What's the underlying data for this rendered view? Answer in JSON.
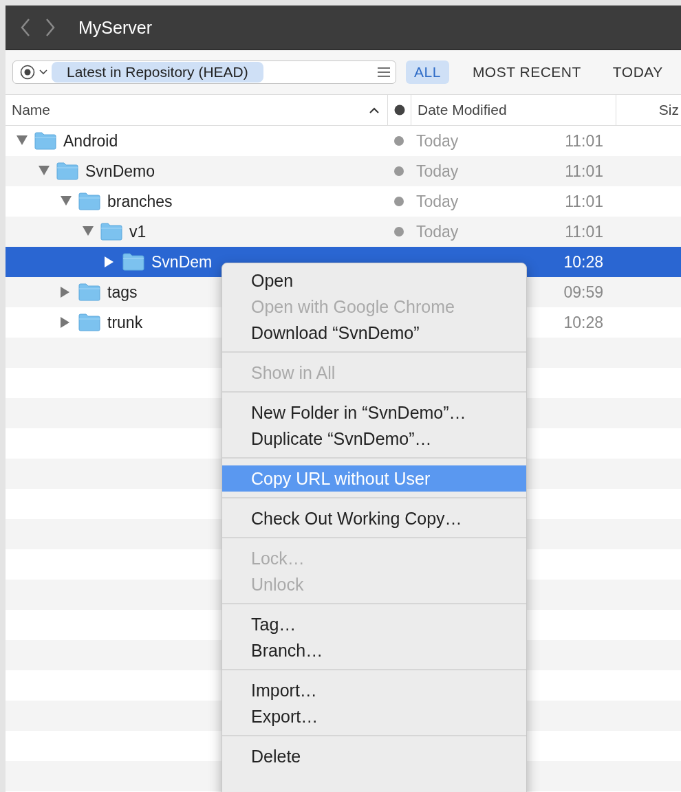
{
  "window": {
    "title": "MyServer"
  },
  "toolbar": {
    "revision": "Latest in Repository (HEAD)",
    "filters": [
      {
        "label": "ALL",
        "selected": true
      },
      {
        "label": "MOST RECENT",
        "selected": false
      },
      {
        "label": "TODAY",
        "selected": false
      }
    ]
  },
  "columns": [
    "Name",
    "Date Modified",
    "Siz"
  ],
  "tree": [
    {
      "name": "Android",
      "expanded": true,
      "selected": false,
      "date": "Today",
      "time": "11:01",
      "children": [
        {
          "name": "SvnDemo",
          "expanded": true,
          "selected": false,
          "date": "Today",
          "time": "11:01",
          "children": [
            {
              "name": "branches",
              "expanded": true,
              "selected": false,
              "date": "Today",
              "time": "11:01",
              "children": [
                {
                  "name": "v1",
                  "expanded": true,
                  "selected": false,
                  "date": "Today",
                  "time": "11:01",
                  "children": [
                    {
                      "name": "SvnDem",
                      "expanded": false,
                      "selected": true,
                      "time": "10:28"
                    }
                  ]
                }
              ]
            },
            {
              "name": "tags",
              "expanded": false,
              "selected": false,
              "time": "09:59"
            },
            {
              "name": "trunk",
              "expanded": false,
              "selected": false,
              "time": "10:28"
            }
          ]
        }
      ]
    }
  ],
  "menu": {
    "groups": [
      {
        "items": [
          {
            "label": "Open",
            "disabled": false,
            "selected": false
          },
          {
            "label": "Open with Google Chrome",
            "disabled": true,
            "selected": false
          },
          {
            "label": "Download “SvnDemo”",
            "disabled": false,
            "selected": false
          }
        ]
      },
      {
        "items": [
          {
            "label": "Show in All",
            "disabled": true,
            "selected": false
          }
        ]
      },
      {
        "items": [
          {
            "label": "New Folder in “SvnDemo”…",
            "disabled": false,
            "selected": false
          },
          {
            "label": "Duplicate “SvnDemo”…",
            "disabled": false,
            "selected": false
          }
        ]
      },
      {
        "items": [
          {
            "label": "Copy URL without User",
            "disabled": false,
            "selected": true
          }
        ]
      },
      {
        "items": [
          {
            "label": "Check Out Working Copy…",
            "disabled": false,
            "selected": false
          }
        ]
      },
      {
        "items": [
          {
            "label": "Lock…",
            "disabled": true,
            "selected": false
          },
          {
            "label": "Unlock",
            "disabled": true,
            "selected": false
          }
        ]
      },
      {
        "items": [
          {
            "label": "Tag…",
            "disabled": false,
            "selected": false
          },
          {
            "label": "Branch…",
            "disabled": false,
            "selected": false
          }
        ]
      },
      {
        "items": [
          {
            "label": "Import…",
            "disabled": false,
            "selected": false
          },
          {
            "label": "Export…",
            "disabled": false,
            "selected": false
          }
        ]
      },
      {
        "items": [
          {
            "label": "Delete",
            "disabled": false,
            "selected": false
          }
        ]
      }
    ]
  }
}
